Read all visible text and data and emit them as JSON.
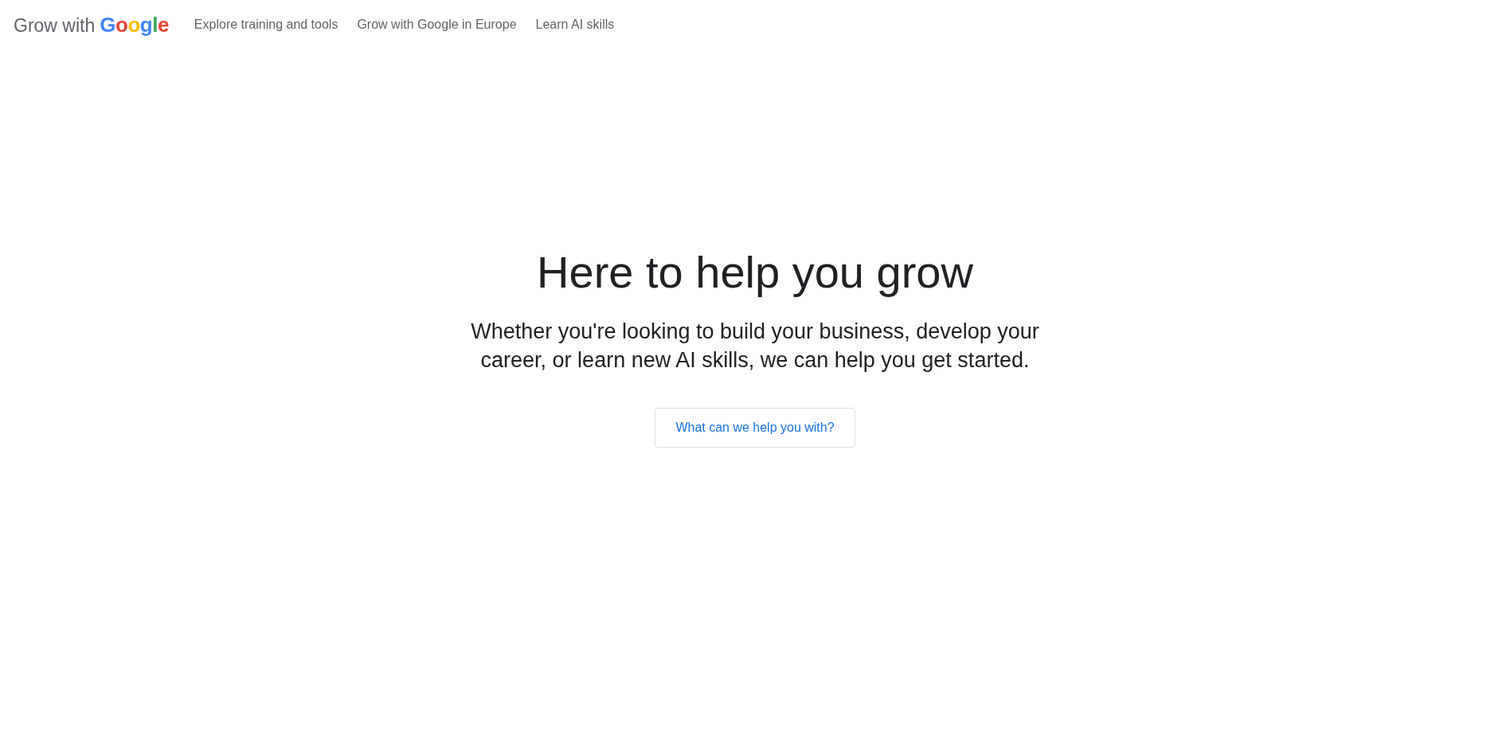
{
  "header": {
    "logo": {
      "text": "Grow with",
      "brand": "Google"
    },
    "nav": [
      {
        "label": "Explore training and tools"
      },
      {
        "label": "Grow with Google in Europe"
      },
      {
        "label": "Learn AI skills"
      }
    ]
  },
  "hero": {
    "title": "Here to help you grow",
    "subtitle": "Whether you're looking to build your business, develop your career, or learn new AI skills, we can help you get started.",
    "button": "What can we help you with?"
  }
}
